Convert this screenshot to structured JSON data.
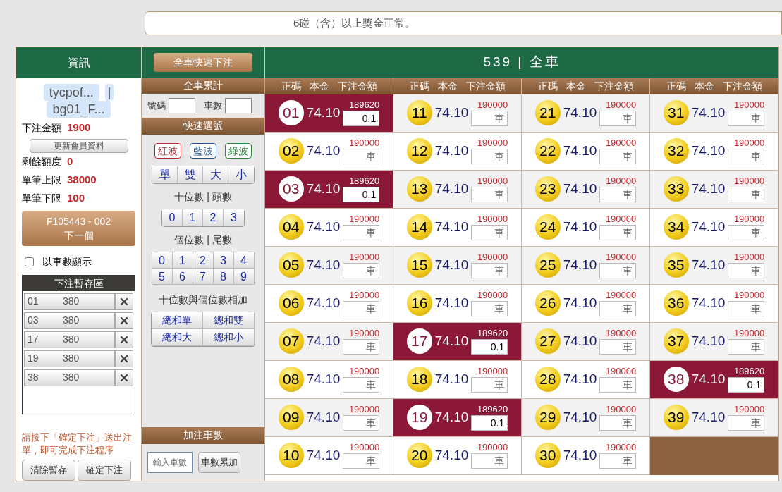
{
  "marquee": "6碰（含）以上獎金正常。",
  "top_bar": {
    "info_title": "資訊",
    "quick_bet_button": "全車快速下注",
    "game_title": "539 | 全車"
  },
  "account": {
    "username": "tycpof...",
    "separator": "|",
    "account_id": "bg01_F...",
    "bet_amount": {
      "label": "下注金額",
      "value": "1900"
    },
    "update_button": "更新會員資料",
    "limits": [
      {
        "label": "剩餘額度",
        "value": "0"
      },
      {
        "label": "單筆上限",
        "value": "38000"
      },
      {
        "label": "單筆下限",
        "value": "100"
      }
    ],
    "next_button": {
      "code": "F105443 - 002",
      "label": "下一個"
    },
    "show_by_count": {
      "label": "以車數顯示",
      "checked": false
    },
    "staging": {
      "title": "下注暫存區",
      "items": [
        {
          "number": "01",
          "amount": "380"
        },
        {
          "number": "03",
          "amount": "380"
        },
        {
          "number": "17",
          "amount": "380"
        },
        {
          "number": "19",
          "amount": "380"
        },
        {
          "number": "38",
          "amount": "380"
        }
      ]
    },
    "notice": "請按下「確定下注」送出注單，即可完成下注程序",
    "buttons": [
      "清除暫存",
      "確定下注"
    ]
  },
  "quick": {
    "total_title": "全車累計",
    "number_label": "號碼",
    "count_label": "車數",
    "quick_title": "快速選號",
    "wave_buttons": [
      {
        "label": "紅波",
        "color": "#b22a2a"
      },
      {
        "label": "藍波",
        "color": "#1f4f8f"
      },
      {
        "label": "綠波",
        "color": "#2a8a3a"
      }
    ],
    "parity_buttons": [
      "單",
      "雙",
      "大",
      "小"
    ],
    "tens_title": "十位數 | 頭數",
    "tens": [
      "0",
      "1",
      "2",
      "3"
    ],
    "units_title": "個位數 | 尾數",
    "units": [
      "0",
      "1",
      "2",
      "3",
      "4",
      "5",
      "6",
      "7",
      "8",
      "9"
    ],
    "sum_title": "十位數與個位數相加",
    "sum_buttons": [
      "總和單",
      "總和雙",
      "總和大",
      "總和小"
    ],
    "add_title": "加注車數",
    "count_placeholder": "輸入車數",
    "accumulate_button": "車數累加"
  },
  "grid": {
    "column_headers": [
      {
        "number": "正碼",
        "odds": "本金",
        "amount": "下注金額"
      },
      {
        "number": "正碼",
        "odds": "本金",
        "amount": "下注金額"
      },
      {
        "number": "正碼",
        "odds": "本金",
        "amount": "下注金額"
      },
      {
        "number": "正碼",
        "odds": "本金",
        "amount": "下注金額"
      }
    ],
    "columns": [
      [
        {
          "number": "01",
          "odds": "74.10",
          "limit": "189620",
          "selected": true,
          "value": "0.1"
        },
        {
          "number": "02",
          "odds": "74.10",
          "limit": "190000",
          "selected": false,
          "placeholder": "車"
        },
        {
          "number": "03",
          "odds": "74.10",
          "limit": "189620",
          "selected": true,
          "value": "0.1"
        },
        {
          "number": "04",
          "odds": "74.10",
          "limit": "190000",
          "selected": false,
          "placeholder": "車"
        },
        {
          "number": "05",
          "odds": "74.10",
          "limit": "190000",
          "selected": false,
          "placeholder": "車"
        },
        {
          "number": "06",
          "odds": "74.10",
          "limit": "190000",
          "selected": false,
          "placeholder": "車"
        },
        {
          "number": "07",
          "odds": "74.10",
          "limit": "190000",
          "selected": false,
          "placeholder": "車"
        },
        {
          "number": "08",
          "odds": "74.10",
          "limit": "190000",
          "selected": false,
          "placeholder": "車"
        },
        {
          "number": "09",
          "odds": "74.10",
          "limit": "190000",
          "selected": false,
          "placeholder": "車"
        },
        {
          "number": "10",
          "odds": "74.10",
          "limit": "190000",
          "selected": false,
          "placeholder": "車"
        }
      ],
      [
        {
          "number": "11",
          "odds": "74.10",
          "limit": "190000",
          "selected": false,
          "placeholder": "車"
        },
        {
          "number": "12",
          "odds": "74.10",
          "limit": "190000",
          "selected": false,
          "placeholder": "車"
        },
        {
          "number": "13",
          "odds": "74.10",
          "limit": "190000",
          "selected": false,
          "placeholder": "車"
        },
        {
          "number": "14",
          "odds": "74.10",
          "limit": "190000",
          "selected": false,
          "placeholder": "車"
        },
        {
          "number": "15",
          "odds": "74.10",
          "limit": "190000",
          "selected": false,
          "placeholder": "車"
        },
        {
          "number": "16",
          "odds": "74.10",
          "limit": "190000",
          "selected": false,
          "placeholder": "車"
        },
        {
          "number": "17",
          "odds": "74.10",
          "limit": "189620",
          "selected": true,
          "value": "0.1"
        },
        {
          "number": "18",
          "odds": "74.10",
          "limit": "190000",
          "selected": false,
          "placeholder": "車"
        },
        {
          "number": "19",
          "odds": "74.10",
          "limit": "189620",
          "selected": true,
          "value": "0.1"
        },
        {
          "number": "20",
          "odds": "74.10",
          "limit": "190000",
          "selected": false,
          "placeholder": "車"
        }
      ],
      [
        {
          "number": "21",
          "odds": "74.10",
          "limit": "190000",
          "selected": false,
          "placeholder": "車"
        },
        {
          "number": "22",
          "odds": "74.10",
          "limit": "190000",
          "selected": false,
          "placeholder": "車"
        },
        {
          "number": "23",
          "odds": "74.10",
          "limit": "190000",
          "selected": false,
          "placeholder": "車"
        },
        {
          "number": "24",
          "odds": "74.10",
          "limit": "190000",
          "selected": false,
          "placeholder": "車"
        },
        {
          "number": "25",
          "odds": "74.10",
          "limit": "190000",
          "selected": false,
          "placeholder": "車"
        },
        {
          "number": "26",
          "odds": "74.10",
          "limit": "190000",
          "selected": false,
          "placeholder": "車"
        },
        {
          "number": "27",
          "odds": "74.10",
          "limit": "190000",
          "selected": false,
          "placeholder": "車"
        },
        {
          "number": "28",
          "odds": "74.10",
          "limit": "190000",
          "selected": false,
          "placeholder": "車"
        },
        {
          "number": "29",
          "odds": "74.10",
          "limit": "190000",
          "selected": false,
          "placeholder": "車"
        },
        {
          "number": "30",
          "odds": "74.10",
          "limit": "190000",
          "selected": false,
          "placeholder": "車"
        }
      ],
      [
        {
          "number": "31",
          "odds": "74.10",
          "limit": "190000",
          "selected": false,
          "placeholder": "車"
        },
        {
          "number": "32",
          "odds": "74.10",
          "limit": "190000",
          "selected": false,
          "placeholder": "車"
        },
        {
          "number": "33",
          "odds": "74.10",
          "limit": "190000",
          "selected": false,
          "placeholder": "車"
        },
        {
          "number": "34",
          "odds": "74.10",
          "limit": "190000",
          "selected": false,
          "placeholder": "車"
        },
        {
          "number": "35",
          "odds": "74.10",
          "limit": "190000",
          "selected": false,
          "placeholder": "車"
        },
        {
          "number": "36",
          "odds": "74.10",
          "limit": "190000",
          "selected": false,
          "placeholder": "車"
        },
        {
          "number": "37",
          "odds": "74.10",
          "limit": "190000",
          "selected": false,
          "placeholder": "車"
        },
        {
          "number": "38",
          "odds": "74.10",
          "limit": "189620",
          "selected": true,
          "value": "0.1"
        },
        {
          "number": "39",
          "odds": "74.10",
          "limit": "190000",
          "selected": false,
          "placeholder": "車"
        }
      ]
    ]
  }
}
